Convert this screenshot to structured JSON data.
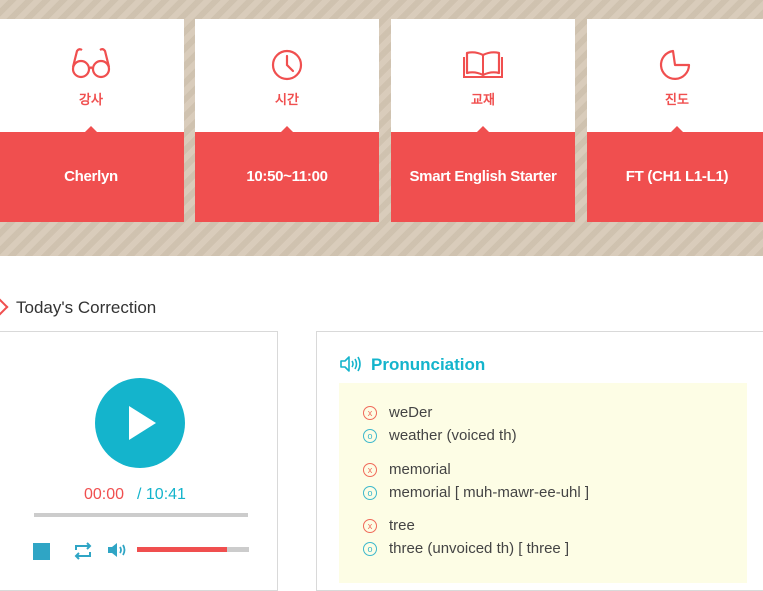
{
  "info_cards": [
    {
      "label": "강사",
      "value": "Cherlyn",
      "icon": "glasses-icon"
    },
    {
      "label": "시간",
      "value": "10:50~11:00",
      "icon": "clock-icon"
    },
    {
      "label": "교재",
      "value": "Smart English Starter",
      "icon": "book-icon"
    },
    {
      "label": "진도",
      "value": "FT (CH1 L1-L1)",
      "icon": "pie-chart-icon"
    }
  ],
  "section": {
    "title": "Today's Correction"
  },
  "player": {
    "current_time": "00:00",
    "total_time": "/ 10:41",
    "progress": 0,
    "volume": 0.8
  },
  "pronunciation": {
    "title": "Pronunciation",
    "items": [
      {
        "wrong": "weDer",
        "correct": "weather (voiced th)"
      },
      {
        "wrong": "memorial",
        "correct": "memorial [ muh-mawr-ee-uhl ]"
      },
      {
        "wrong": "tree",
        "correct": "three (unvoiced th) [ three ]"
      }
    ],
    "wrong_mark": "x",
    "correct_mark": "o"
  },
  "colors": {
    "accent_red": "#f04f4f",
    "accent_teal": "#14b4cc",
    "banner_bg": "#d6c8b5",
    "pron_bg": "#fdfde5"
  }
}
